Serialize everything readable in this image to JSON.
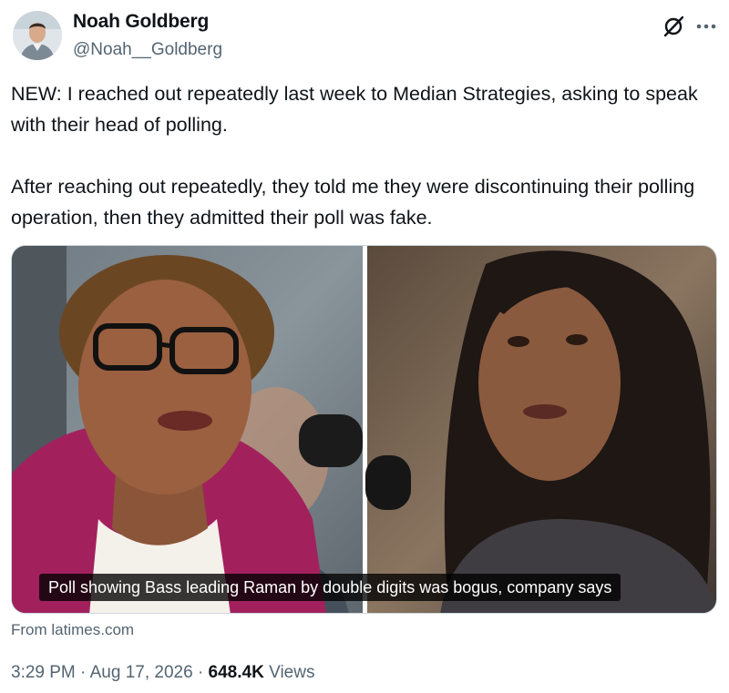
{
  "author": {
    "display_name": "Noah Goldberg",
    "handle": "@Noah__Goldberg"
  },
  "header": {
    "grok_icon": "grok-icon",
    "more_icon": "more-options-icon"
  },
  "body": {
    "paragraph_1": "NEW: I reached out repeatedly last week to Median Strategies, asking to speak with their head of polling.",
    "paragraph_2": "After reaching out repeatedly, they told me they were discontinuing their polling operation, then they admitted their poll was fake."
  },
  "card": {
    "caption": "Poll showing Bass leading Raman by double digits was bogus, company says",
    "source": "From latimes.com"
  },
  "meta": {
    "time": "3:29 PM",
    "separator": "·",
    "date": "Aug 17, 2026",
    "views_count": "648.4K",
    "views_label": "Views"
  },
  "colors": {
    "text_primary": "#0f1419",
    "text_secondary": "#536471",
    "border": "#cfd9de"
  }
}
